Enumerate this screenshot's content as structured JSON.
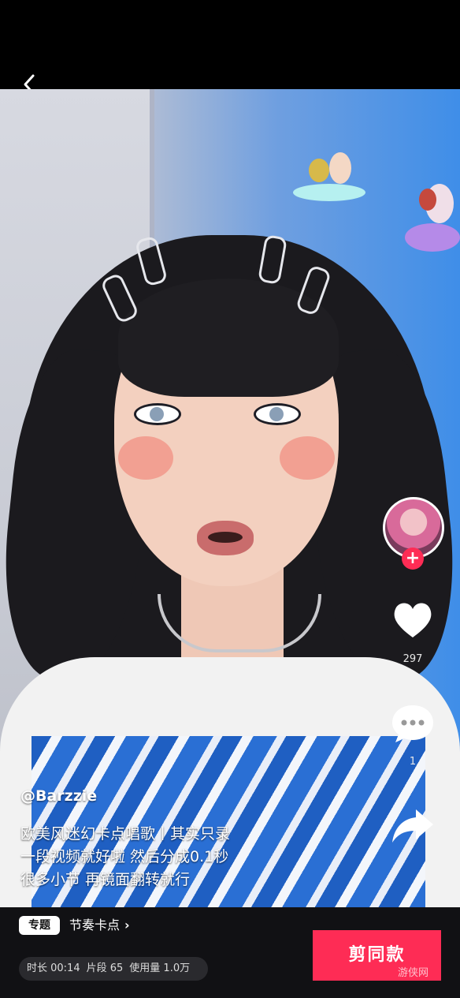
{
  "nav": {
    "back_icon": "chevron-left-icon"
  },
  "video": {
    "author": "@Barzzie",
    "caption_lines": [
      "欧美风迷幻卡点唱歌丨其实只录",
      "一段视频就好啦 然后分成0.1秒",
      "很多小节 再镜面翻转就行"
    ]
  },
  "actions": {
    "like_count": "297",
    "comment_count": "1",
    "follow_symbol": "+"
  },
  "footer": {
    "badge": "专题",
    "topic": "节奏卡点",
    "topic_chevron": "›",
    "stats": {
      "duration": "时长 00:14",
      "segments": "片段 65",
      "usage": "使用量 1.0万"
    },
    "cta": "剪同款",
    "watermark": "游侠网"
  },
  "colors": {
    "accent": "#fe2c55",
    "bottom_bar": "#111114"
  }
}
